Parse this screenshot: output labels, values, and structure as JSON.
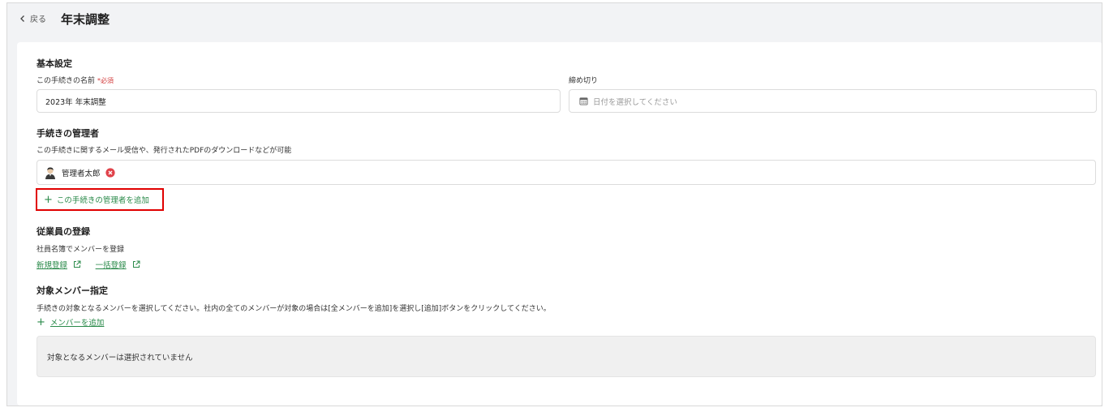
{
  "header": {
    "back_label": "戻る",
    "title": "年末調整"
  },
  "basic_settings": {
    "heading": "基本設定",
    "name_label": "この手続きの名前",
    "required_label": "*必須",
    "name_value": "2023年 年末調整",
    "deadline_label": "締め切り",
    "deadline_placeholder": "日付を選択してください"
  },
  "admins": {
    "heading": "手続きの管理者",
    "description": "この手続きに関するメール受信や、発行されたPDFのダウンロードなどが可能",
    "admin_chip": "管理者太郎",
    "add_label": "この手続きの管理者を追加"
  },
  "employee_registration": {
    "heading": "従業員の登録",
    "description": "社員名簿でメンバーを登録",
    "new_link": "新規登録",
    "bulk_link": "一括登録"
  },
  "target_members": {
    "heading": "対象メンバー指定",
    "description": "手続きの対象となるメンバーを選択してください。社内の全てのメンバーが対象の場合は[全メンバーを追加]を選択し[追加]ボタンをクリックしてください。",
    "add_label": "メンバーを追加",
    "empty_text": "対象となるメンバーは選択されていません"
  },
  "colors": {
    "accent_green": "#2a8a4a",
    "highlight_red": "#e00000",
    "required_red": "#d23b3b"
  }
}
